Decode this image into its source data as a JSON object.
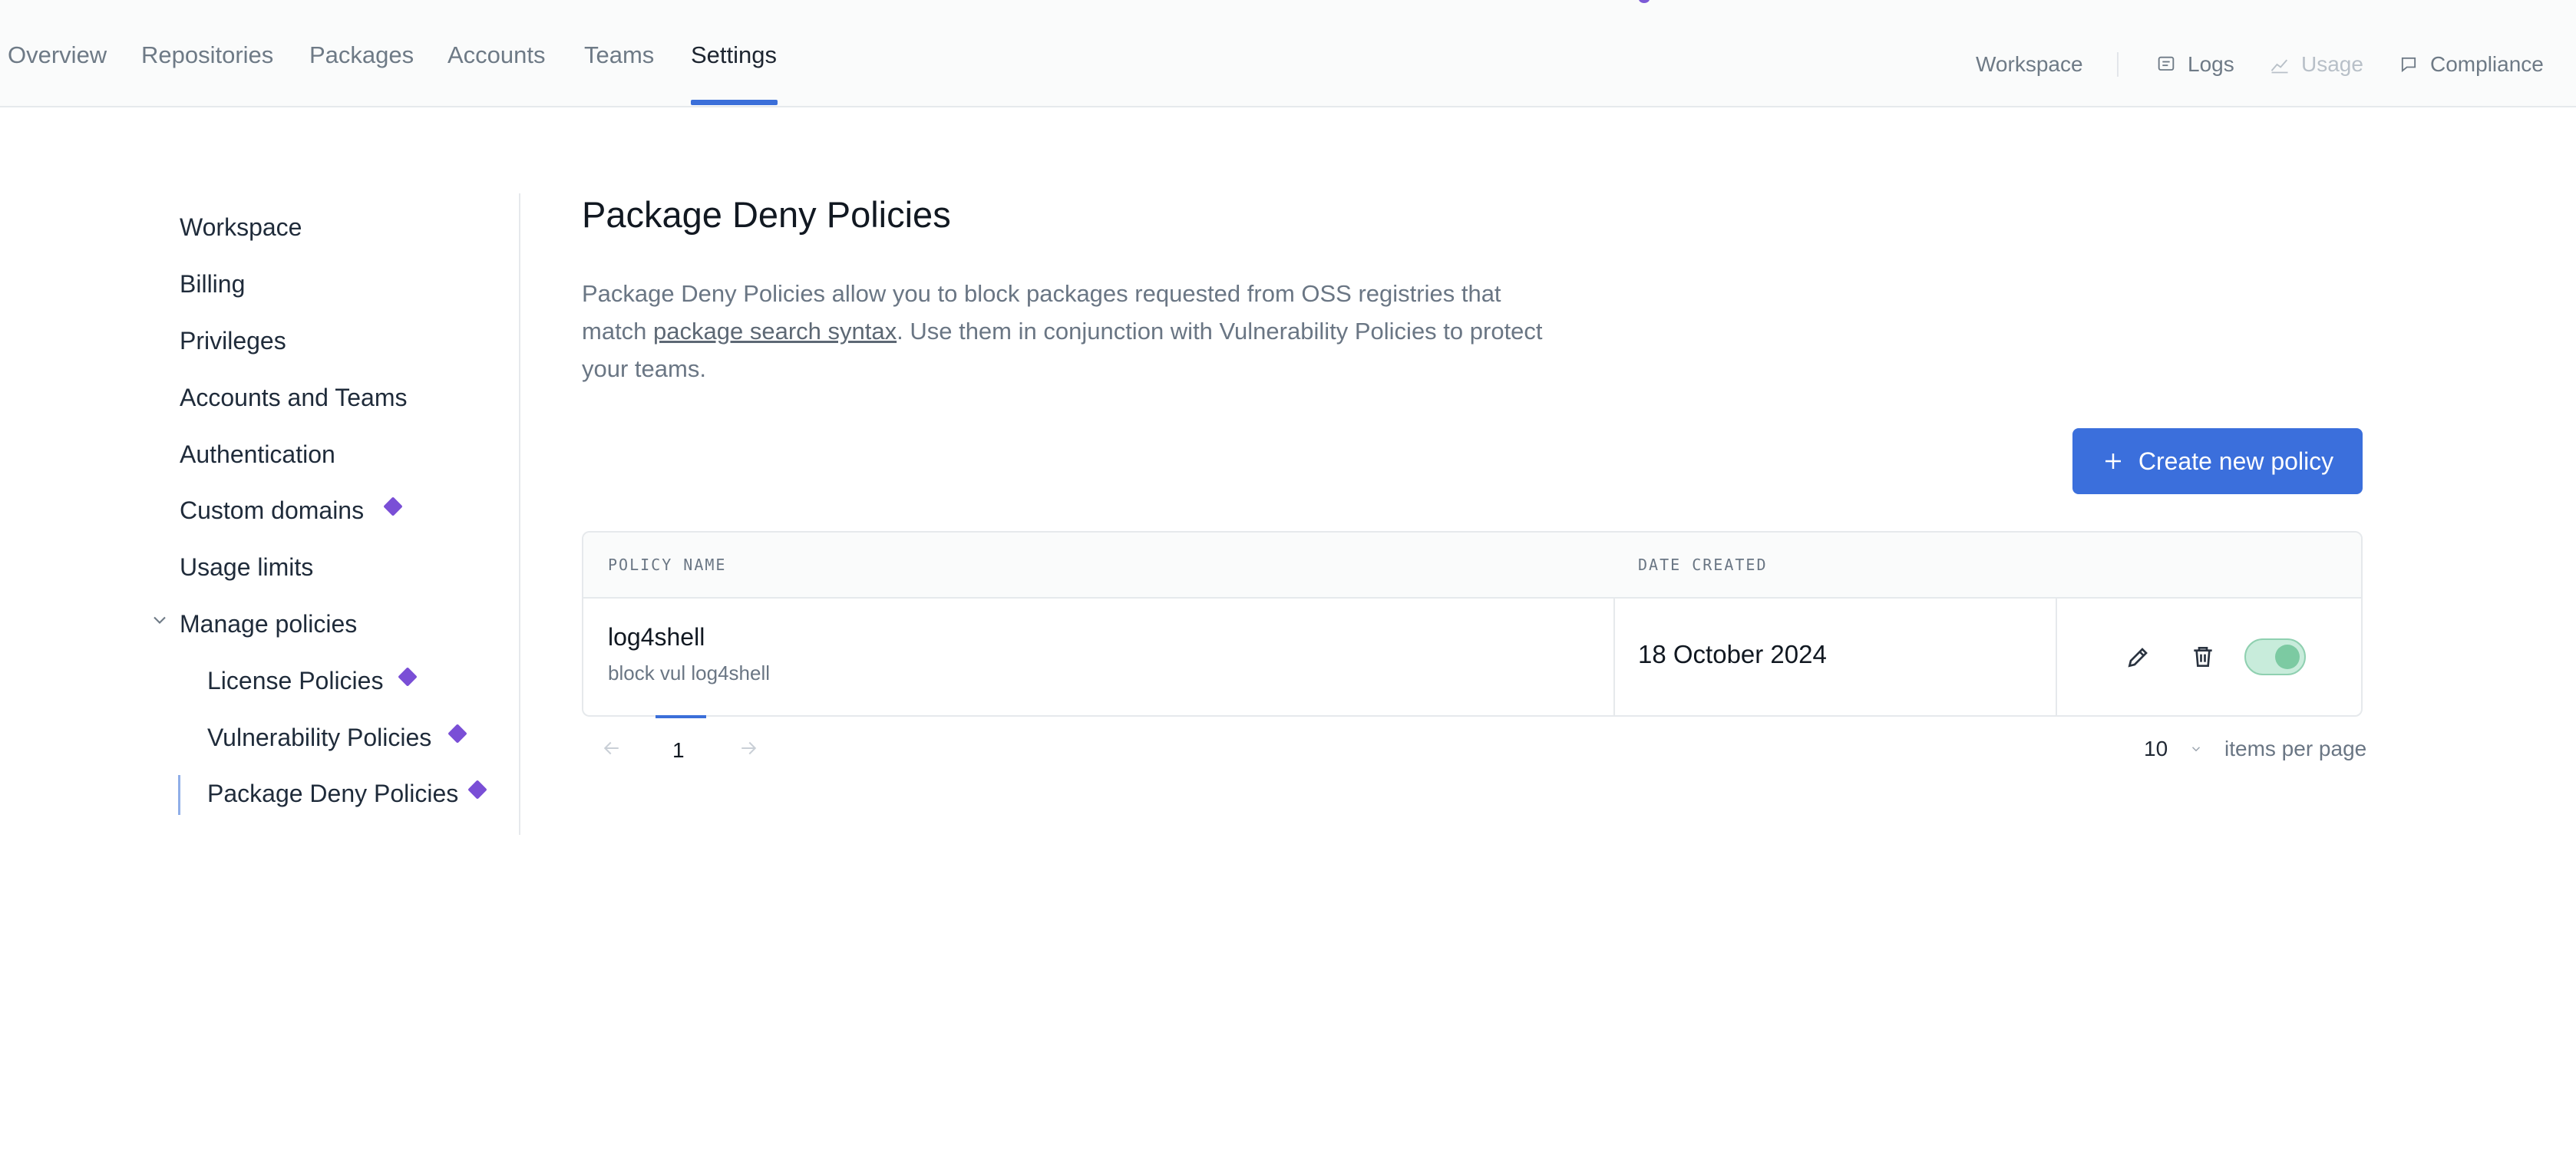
{
  "nav": {
    "tabs": [
      "Overview",
      "Repositories",
      "Packages",
      "Accounts",
      "Teams",
      "Settings"
    ],
    "active_tab": "Settings"
  },
  "top_right": {
    "workspace": "Workspace",
    "logs": "Logs",
    "usage": "Usage",
    "compliance": "Compliance"
  },
  "sidebar": {
    "items": [
      {
        "label": "Workspace"
      },
      {
        "label": "Billing"
      },
      {
        "label": "Privileges"
      },
      {
        "label": "Accounts and Teams"
      },
      {
        "label": "Authentication"
      },
      {
        "label": "Custom domains",
        "badge": "premium-diamond-icon"
      },
      {
        "label": "Usage limits"
      },
      {
        "label": "Manage policies",
        "expanded": true
      },
      {
        "label": "License Policies",
        "badge": "premium-diamond-icon"
      },
      {
        "label": "Vulnerability Policies",
        "badge": "premium-diamond-icon"
      },
      {
        "label": "Package Deny Policies",
        "badge": "premium-diamond-icon",
        "active": true
      }
    ]
  },
  "main": {
    "title": "Package Deny Policies",
    "desc_part1": "Package Deny Policies allow you to block packages requested from OSS registries that match ",
    "desc_link": "package search syntax",
    "desc_part2": ". Use them in conjunction with Vulnerability Policies to protect your teams.",
    "create_button": "Create new policy",
    "table": {
      "headers": [
        "POLICY NAME",
        "DATE CREATED"
      ],
      "rows": [
        {
          "name": "log4shell",
          "description": "block vul log4shell",
          "date": "18 October 2024",
          "enabled": true
        }
      ]
    },
    "pagination": {
      "current_page": "1",
      "per_page": "10",
      "per_page_label": "items per page"
    }
  },
  "colors": {
    "accent": "#3b6fdc",
    "premium": "#7a4fd6",
    "toggle_on": "#7ccaa2"
  }
}
